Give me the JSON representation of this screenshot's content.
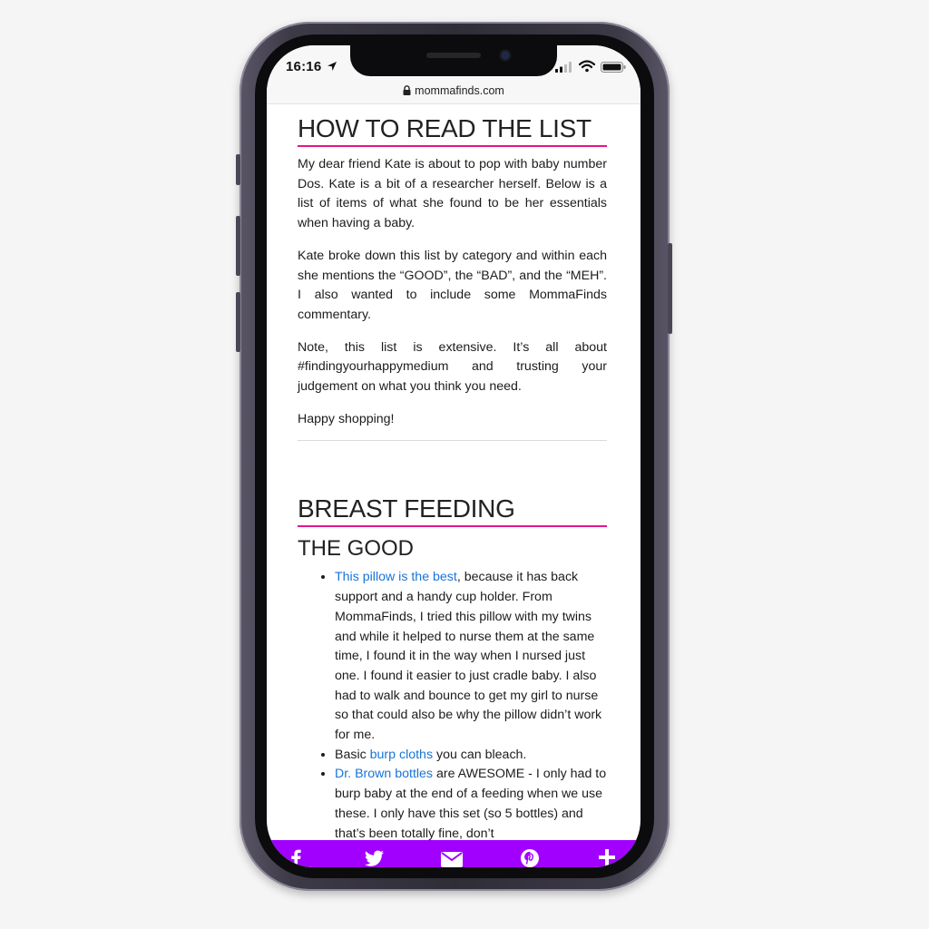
{
  "status_bar": {
    "time": "16:16"
  },
  "browser": {
    "url": "mommafinds.com"
  },
  "article": {
    "section1": {
      "heading": "HOW TO READ THE LIST",
      "paragraphs": [
        "My dear friend Kate is about to pop with baby number Dos. Kate is a bit of a researcher herself. Below is a list of items of what she found to be her essentials when having a baby.",
        "Kate broke down this list by category and within each she mentions the “GOOD”, the “BAD”, and the “MEH”. I also wanted to include some MommaFinds commentary.",
        "Note, this list is extensive. It’s all about #findingyourhappymedium and trusting your judgement on what you think you need.",
        "Happy shopping!"
      ]
    },
    "section2": {
      "heading": "BREAST FEEDING",
      "subheading": "THE GOOD",
      "items": [
        {
          "link": "This pillow is the best",
          "text": ", because it has back support and a handy cup holder. From MommaFinds, I tried this pillow with my twins and while it helped to nurse them at the same time, I found it in the way when I nursed just one. I found it easier to just cradle baby. I also had to walk and bounce to get my girl to nurse so that could also be why the pillow didn’t work for me."
        },
        {
          "prefix": "Basic ",
          "link": "burp cloths",
          "text": " you can bleach."
        },
        {
          "link": "Dr. Brown bottles",
          "text": " are AWESOME - I only had to burp baby at the end of a feeding when we use these. I only have this set (so 5 bottles) and that’s been totally fine, don’t"
        }
      ]
    }
  },
  "share_bar": {
    "color": "#a100ff",
    "icons": [
      "facebook-icon",
      "twitter-icon",
      "email-icon",
      "pinterest-icon",
      "plus-icon"
    ]
  },
  "colors": {
    "heading_underline": "#e5158a",
    "link": "#1a73d9"
  }
}
